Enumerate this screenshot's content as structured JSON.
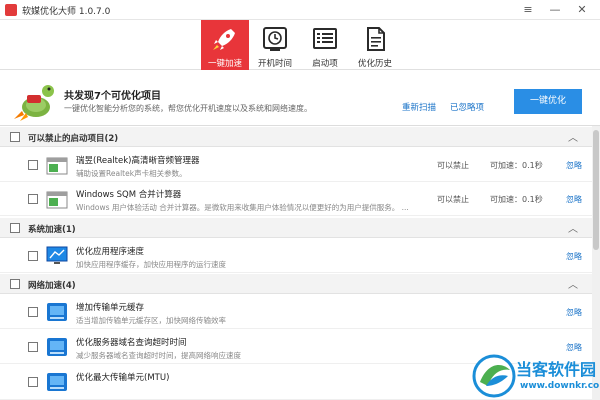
{
  "window": {
    "title": "软媒优化大师 1.0.7.0",
    "controls": [
      "≡",
      "—",
      "✕"
    ]
  },
  "toolbar": {
    "tabs": [
      {
        "label": "一键加速",
        "icon": "rocket-icon",
        "active": true
      },
      {
        "label": "开机时间",
        "icon": "clock-icon",
        "active": false
      },
      {
        "label": "启动项",
        "icon": "list-icon",
        "active": false
      },
      {
        "label": "优化历史",
        "icon": "document-icon",
        "active": false
      }
    ],
    "active_color": "#e8353a"
  },
  "hero": {
    "title": "共发现7个可优化项目",
    "subtitle": "一键优化智能分析您的系统，帮您优化开机速度以及系统和网络速度。",
    "rescan_link": "重新扫描",
    "ignored_link": "已忽略项",
    "optimize_button": "一键优化"
  },
  "sections": [
    {
      "title": "可以禁止的启动项目(2)",
      "items": [
        {
          "title": "瑞昱(Realtek)高清晰音频管理器",
          "desc": "辅助设置Realtek声卡相关参数。",
          "status": "可以禁止",
          "speed": "可加速：0.1秒",
          "action": "忽略",
          "icon": "app-window-icon"
        },
        {
          "title": "Windows SQM 合并计算器",
          "desc": "Windows 用户体验活动 合并计算器。是微软用来收集用户体验情况以便更好的为用户提供服务。 ...",
          "status": "可以禁止",
          "speed": "可加速：0.1秒",
          "action": "忽略",
          "icon": "app-window-icon"
        }
      ]
    },
    {
      "title": "系统加速(1)",
      "items": [
        {
          "title": "优化应用程序速度",
          "desc": "加快应用程序缓存，加快应用程序的运行速度",
          "action": "忽略",
          "icon": "monitor-icon"
        }
      ]
    },
    {
      "title": "网络加速(4)",
      "items": [
        {
          "title": "增加传输单元缓存",
          "desc": "适当增加传输单元缓存区，加快网络传输效率",
          "action": "忽略",
          "icon": "network-icon"
        },
        {
          "title": "优化服务器域名查询超时时间",
          "desc": "减少服务器域名查询超时时间，提高网络响应速度",
          "action": "忽略",
          "icon": "network-icon"
        },
        {
          "title": "优化最大传输单元(MTU)",
          "desc": "",
          "action": "",
          "icon": "network-icon"
        }
      ]
    }
  ],
  "watermark": {
    "name": "当客软件园",
    "url": "www.downkr.com"
  }
}
